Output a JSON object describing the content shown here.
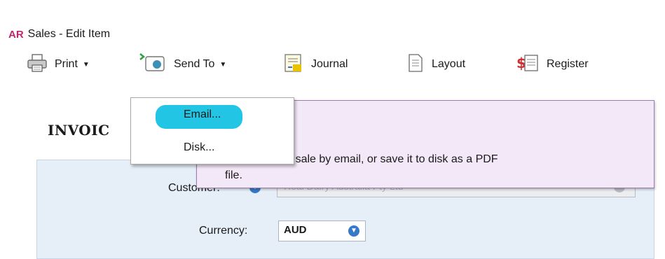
{
  "window": {
    "app_badge": "AR",
    "title": "Sales - Edit Item"
  },
  "toolbar": {
    "print_label": "Print",
    "sendto_label": "Send To",
    "journal_label": "Journal",
    "layout_label": "Layout",
    "register_label": "Register"
  },
  "sendto_menu": {
    "items": [
      "Email...",
      "Disk..."
    ]
  },
  "tooltip": {
    "text_line1": "rm for this sale by email, or save it to disk as a PDF",
    "text_line2": "file."
  },
  "form": {
    "heading": "INVOIC",
    "customer_label": "Customer:",
    "customer_value": "Real Dairy Australia Pty Ltd",
    "currency_label": "Currency:",
    "currency_value": "AUD"
  },
  "colors": {
    "highlight": "#22c6e4",
    "tooltip_bg": "#f3e8f7",
    "panel_bg": "#e6eff8",
    "accent": "#3579c8"
  },
  "icons": [
    "printer-icon",
    "send-to-icon",
    "journal-icon",
    "layout-icon",
    "register-icon",
    "dropdown-icon",
    "help-icon"
  ]
}
